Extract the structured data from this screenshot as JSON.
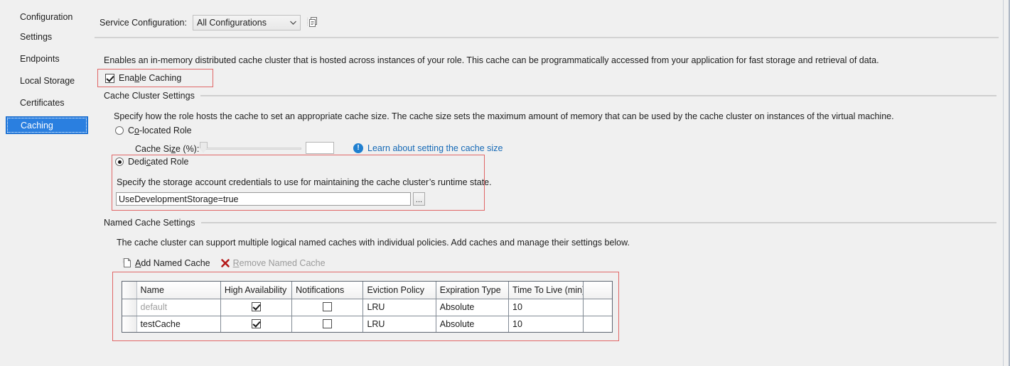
{
  "sidebar": {
    "items": [
      {
        "label": "Configuration",
        "selected": false
      },
      {
        "label": "Settings",
        "selected": false
      },
      {
        "label": "Endpoints",
        "selected": false
      },
      {
        "label": "Local Storage",
        "selected": false
      },
      {
        "label": "Certificates",
        "selected": false
      },
      {
        "label": "Caching",
        "selected": true
      }
    ]
  },
  "toolbar": {
    "service_configuration_label": "Service Configuration:",
    "service_configuration_value": "All Configurations",
    "dropdown_arrow": "⌄",
    "copy_icon_name": "copy-configuration-icon"
  },
  "caching": {
    "description": "Enables an in-memory distributed cache cluster that is hosted across instances of your role. This cache can be programmatically accessed from your application for fast storage and retrieval of data.",
    "enable_caching_label_pre": "Ena",
    "enable_caching_label_accel": "b",
    "enable_caching_label_post": "le Caching",
    "enable_caching_checked": true
  },
  "cache_cluster": {
    "group_title": "Cache Cluster Settings",
    "description": "Specify how the role hosts the cache to set an appropriate cache size. The cache size sets the maximum amount of memory that can be used by the cache cluster on instances of the virtual machine.",
    "co_located": {
      "label_pre": "C",
      "label_accel": "o",
      "label_post": "-located Role",
      "selected": false
    },
    "cache_size": {
      "label_pre": "Cache Si",
      "label_accel": "z",
      "label_post": "e (%):",
      "value": "",
      "slider_position_pct": 0,
      "enabled": false
    },
    "info_link": {
      "icon": "!",
      "icon_name": "info-icon",
      "text": "Learn about setting the cache size"
    },
    "dedicated": {
      "label_pre": "Dedi",
      "label_accel": "c",
      "label_post": "ated Role",
      "selected": true,
      "description": "Specify the storage account credentials to use for maintaining the cache cluster’s runtime state.",
      "connection_string": "UseDevelopmentStorage=true",
      "browse_button_label": "..."
    }
  },
  "named_cache": {
    "group_title": "Named Cache Settings",
    "description": "The cache cluster can support multiple logical named caches with individual policies. Add caches and manage their settings below.",
    "commands": [
      {
        "label_pre": "",
        "label_accel": "A",
        "label_post": "dd Named Cache",
        "icon_name": "add-page-icon",
        "disabled": false
      },
      {
        "label_pre": "",
        "label_accel": "R",
        "label_post": "emove Named Cache",
        "icon_name": "remove-x-icon",
        "disabled": true
      }
    ],
    "table": {
      "columns": [
        "Name",
        "High Availability",
        "Notifications",
        "Eviction Policy",
        "Expiration Type",
        "Time To Live (min)"
      ],
      "rows": [
        {
          "name": "default",
          "name_dim": true,
          "high_availability": true,
          "notifications": false,
          "eviction_policy": "LRU",
          "expiration_type": "Absolute",
          "time_to_live": "10"
        },
        {
          "name": "testCache",
          "name_dim": false,
          "high_availability": true,
          "notifications": false,
          "eviction_policy": "LRU",
          "expiration_type": "Absolute",
          "time_to_live": "10"
        }
      ]
    }
  },
  "colors": {
    "selection_blue": "#2a7fe0",
    "annotation_red": "#e06666",
    "link_blue": "#1569b6",
    "info_blue": "#1f7fd0",
    "remove_x_red": "#b51a1a",
    "background": "#f0f0f0"
  }
}
